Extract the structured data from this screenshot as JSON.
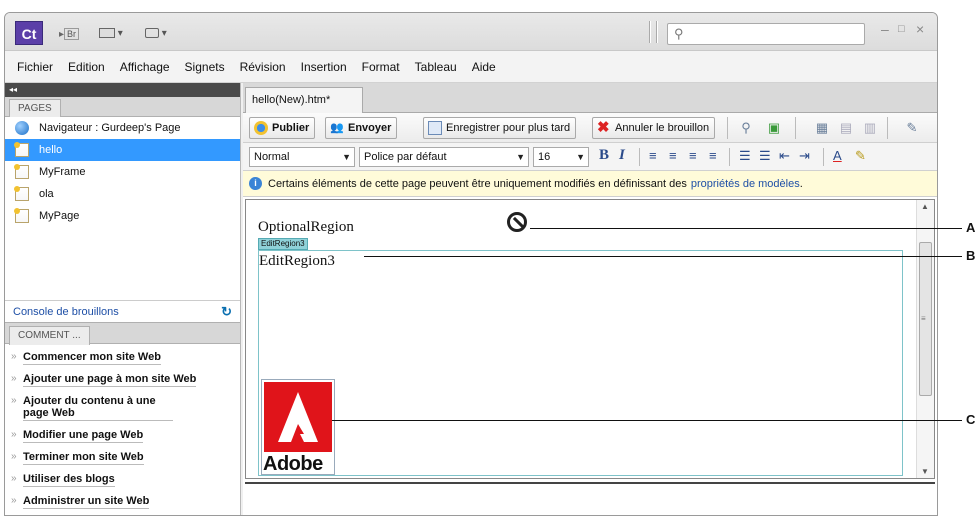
{
  "titlebar": {
    "app_logo": "Ct",
    "bridge_label": "Br",
    "layout_menu_icon": "layout-icon",
    "view_menu_icon": "monitor-icon",
    "search_placeholder": "",
    "window_controls": [
      "–",
      "□",
      "×"
    ]
  },
  "menubar": {
    "items": [
      "Fichier",
      "Edition",
      "Affichage",
      "Signets",
      "Révision",
      "Insertion",
      "Format",
      "Tableau",
      "Aide"
    ]
  },
  "left_panel": {
    "collapse_glyph": "◂◂",
    "pages_tab": "PAGES",
    "pages": [
      {
        "label": "Navigateur : Gurdeep's Page",
        "icon": "globe-icon",
        "selected": false
      },
      {
        "label": "hello",
        "icon": "page-icon",
        "selected": true
      },
      {
        "label": "MyFrame",
        "icon": "page-icon",
        "selected": false
      },
      {
        "label": "ola",
        "icon": "page-icon",
        "selected": false
      },
      {
        "label": "MyPage",
        "icon": "page-icon",
        "selected": false
      }
    ],
    "console_label": "Console de brouillons",
    "comment_tab": "COMMENT ...",
    "how_to": [
      "Commencer mon site Web",
      "Ajouter une page à mon site Web",
      "Ajouter du contenu à une page Web",
      "Modifier une page Web",
      "Terminer mon site Web",
      "Utiliser des blogs",
      "Administrer un site Web"
    ]
  },
  "document": {
    "tab_label": "hello(New).htm*",
    "toolbar": {
      "publish": "Publier",
      "send": "Envoyer",
      "save_later": "Enregistrer pour plus tard",
      "cancel_draft": "Annuler le brouillon"
    },
    "format": {
      "style": "Normal",
      "font": "Police par défaut",
      "size": "16",
      "bold": "B",
      "italic": "I"
    },
    "info_text": "Certains éléments de cette page peuvent être uniquement modifiés en définissant des",
    "info_link": "propriétés de modèles",
    "info_end": "."
  },
  "editor": {
    "optional_region": "OptionalRegion",
    "edit_region_tag": "EditRegion3",
    "edit_region_text": "EditRegion3",
    "logo_word": "Adobe"
  },
  "callouts": [
    "A",
    "B",
    "C"
  ]
}
